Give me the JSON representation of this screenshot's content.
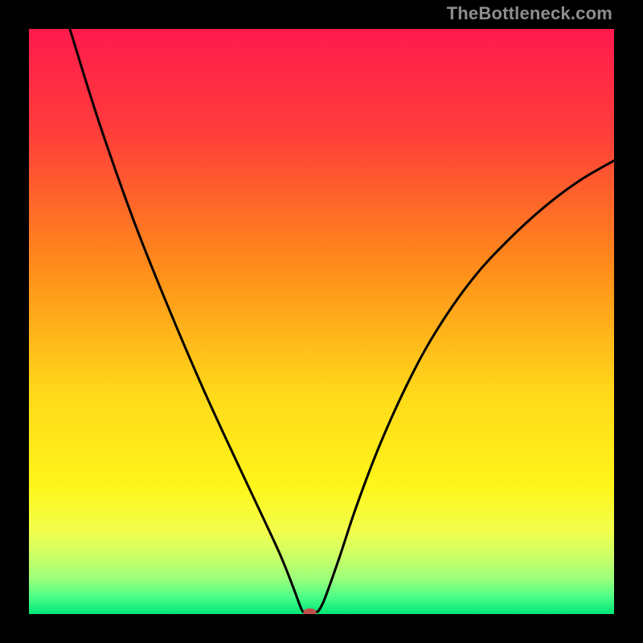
{
  "watermark": "TheBottleneck.com",
  "chart_data": {
    "type": "line",
    "title": "",
    "xlabel": "",
    "ylabel": "",
    "xlim": [
      0,
      100
    ],
    "ylim": [
      0,
      100
    ],
    "background_gradient_stops": [
      {
        "pct": 0,
        "color": "#ff1a4d"
      },
      {
        "pct": 18,
        "color": "#ff3e3a"
      },
      {
        "pct": 40,
        "color": "#ff8a1a"
      },
      {
        "pct": 62,
        "color": "#ffd81a"
      },
      {
        "pct": 78,
        "color": "#fff51a"
      },
      {
        "pct": 86,
        "color": "#f1ff4d"
      },
      {
        "pct": 90,
        "color": "#ccff66"
      },
      {
        "pct": 94,
        "color": "#9cff7a"
      },
      {
        "pct": 97,
        "color": "#4dff87"
      },
      {
        "pct": 100,
        "color": "#00e676"
      }
    ],
    "curve_points_left": [
      {
        "x": 7.0,
        "y": 100.0
      },
      {
        "x": 12.0,
        "y": 84.0
      },
      {
        "x": 18.0,
        "y": 67.0
      },
      {
        "x": 24.0,
        "y": 52.0
      },
      {
        "x": 30.0,
        "y": 38.0
      },
      {
        "x": 36.0,
        "y": 25.0
      },
      {
        "x": 40.0,
        "y": 16.5
      },
      {
        "x": 43.0,
        "y": 10.0
      },
      {
        "x": 45.0,
        "y": 5.0
      },
      {
        "x": 46.3,
        "y": 1.5
      },
      {
        "x": 46.8,
        "y": 0.4
      }
    ],
    "curve_points_right": [
      {
        "x": 49.4,
        "y": 0.4
      },
      {
        "x": 50.5,
        "y": 2.5
      },
      {
        "x": 53.0,
        "y": 9.5
      },
      {
        "x": 56.0,
        "y": 18.5
      },
      {
        "x": 60.0,
        "y": 29.0
      },
      {
        "x": 65.0,
        "y": 40.0
      },
      {
        "x": 70.0,
        "y": 49.0
      },
      {
        "x": 76.0,
        "y": 57.5
      },
      {
        "x": 82.0,
        "y": 64.0
      },
      {
        "x": 88.0,
        "y": 69.5
      },
      {
        "x": 94.0,
        "y": 74.0
      },
      {
        "x": 100.0,
        "y": 77.5
      }
    ],
    "marker": {
      "x": 48.0,
      "y": 0.3,
      "color": "#c0504d"
    }
  }
}
